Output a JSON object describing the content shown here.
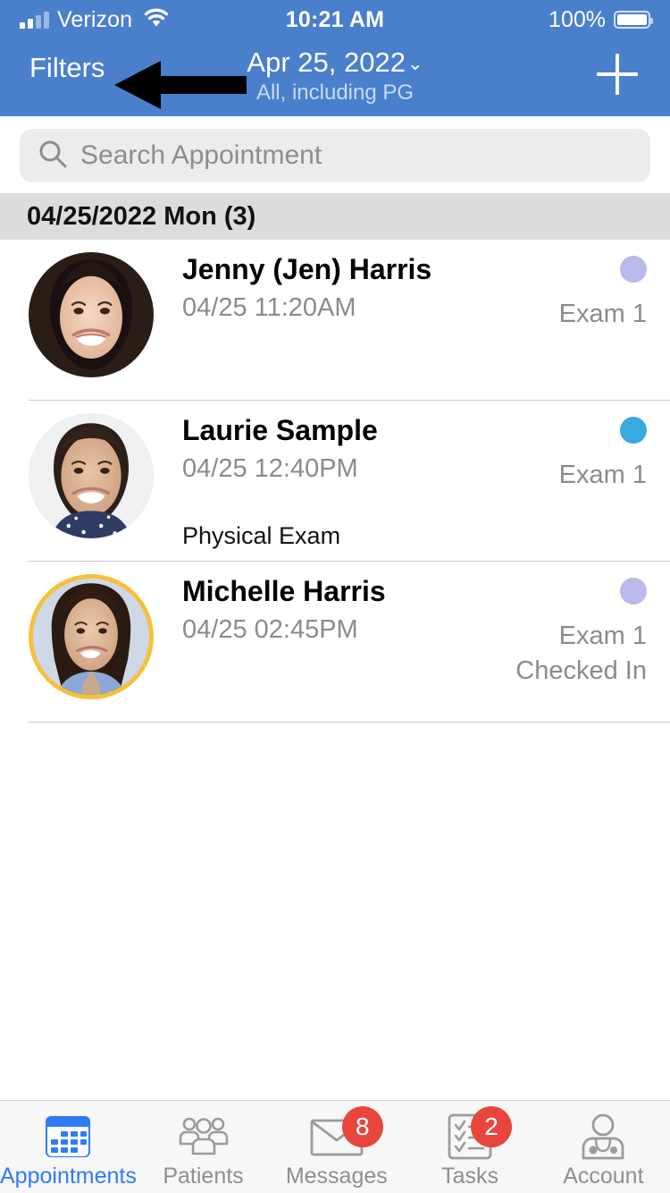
{
  "status_bar": {
    "carrier": "Verizon",
    "time": "10:21 AM",
    "battery_percent": "100%",
    "signal_icon": "signal-bars-icon",
    "wifi_icon": "wifi-icon",
    "battery_icon": "battery-full-icon"
  },
  "nav": {
    "filters_label": "Filters",
    "date_label": "Apr 25, 2022",
    "date_chevron": "⌄",
    "subtitle": "All, including PG",
    "add_icon": "plus-icon",
    "annotation_icon": "left-arrow-annotation"
  },
  "search": {
    "placeholder": "Search Appointment",
    "value": "",
    "icon": "search-icon"
  },
  "section": {
    "header": "04/25/2022 Mon (3)"
  },
  "appointments": [
    {
      "name": "Jenny (Jen) Harris",
      "time": "04/25 11:20AM",
      "note": "",
      "room": "Exam 1",
      "status": "",
      "dot_color": "#b9b9ec",
      "avatar_ring": false
    },
    {
      "name": "Laurie Sample",
      "time": "04/25 12:40PM",
      "note": "Physical Exam",
      "room": "Exam 1",
      "status": "",
      "dot_color": "#3aa9e0",
      "avatar_ring": false
    },
    {
      "name": "Michelle Harris",
      "time": "04/25 02:45PM",
      "note": "",
      "room": "Exam 1",
      "status": "Checked In",
      "dot_color": "#b9b9ec",
      "avatar_ring": true
    }
  ],
  "tabs": [
    {
      "label": "Appointments",
      "icon": "calendar-icon",
      "badge": "",
      "active": true
    },
    {
      "label": "Patients",
      "icon": "people-group-icon",
      "badge": "",
      "active": false
    },
    {
      "label": "Messages",
      "icon": "envelope-icon",
      "badge": "8",
      "active": false
    },
    {
      "label": "Tasks",
      "icon": "checklist-icon",
      "badge": "2",
      "active": false
    },
    {
      "label": "Account",
      "icon": "doctor-icon",
      "badge": "",
      "active": false
    }
  ],
  "colors": {
    "header_blue": "#4a7fcc",
    "accent_blue": "#2f7bf6",
    "badge_red": "#e8453c",
    "section_gray": "#dcdcdc",
    "ring_yellow": "#f5c13c"
  }
}
